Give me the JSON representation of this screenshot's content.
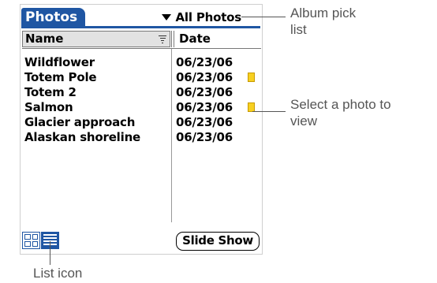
{
  "app": {
    "title": "Photos",
    "album_picker": "All Photos"
  },
  "columns": {
    "name": "Name",
    "date": "Date"
  },
  "rows": [
    {
      "name": "Wildflower",
      "date": "06/23/06",
      "note": false
    },
    {
      "name": "Totem Pole",
      "date": "06/23/06",
      "note": true
    },
    {
      "name": "Totem 2",
      "date": "06/23/06",
      "note": false
    },
    {
      "name": "Salmon",
      "date": "06/23/06",
      "note": true
    },
    {
      "name": "Glacier approach",
      "date": "06/23/06",
      "note": false
    },
    {
      "name": "Alaskan shoreline",
      "date": "06/23/06",
      "note": false
    }
  ],
  "footer": {
    "slideshow_label": "Slide Show"
  },
  "callouts": {
    "album": [
      "Album pick",
      "list"
    ],
    "select": [
      "Select a photo to",
      "view"
    ],
    "list_icon": "List icon"
  },
  "colors": {
    "accent": "#1f56a3",
    "note": "#f7d021"
  }
}
